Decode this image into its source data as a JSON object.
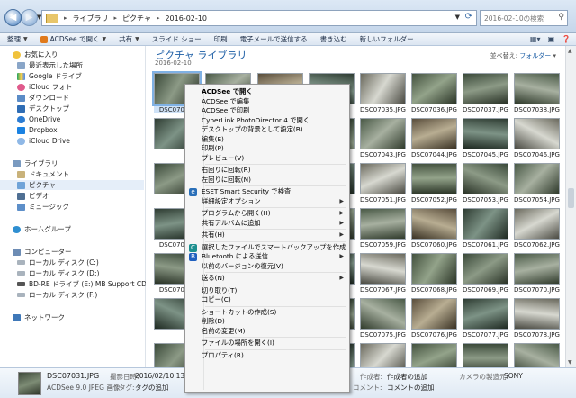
{
  "address": {
    "path": [
      "ライブラリ",
      "ピクチャ",
      "2016-02-10"
    ],
    "search_placeholder": "2016-02-10の検索"
  },
  "toolbar": {
    "items": [
      "整理",
      "ACDSee で開く",
      "共有",
      "スライド ショー",
      "印刷",
      "電子メールで送信する",
      "書き込む",
      "新しいフォルダー"
    ]
  },
  "sidebar": {
    "favorites_header": "お気に入り",
    "favorites": [
      "最近表示した場所",
      "Google ドライブ",
      "iCloud フォト",
      "ダウンロード",
      "デスクトップ",
      "OneDrive",
      "Dropbox",
      "iCloud Drive"
    ],
    "libraries_header": "ライブラリ",
    "libraries": [
      "ドキュメント",
      "ピクチャ",
      "ビデオ",
      "ミュージック"
    ],
    "homegroup": "ホームグループ",
    "computer_header": "コンピューター",
    "drives": [
      "ローカル ディスク (C:)",
      "ローカル ディスク (D:)",
      "BD-RE ドライブ (E:) MB Support CD",
      "ローカル ディスク (F:)"
    ],
    "network": "ネットワーク"
  },
  "library": {
    "title": "ピクチャ ライブラリ",
    "subtitle": "2016-02-10",
    "arrange_label": "並べ替え:",
    "arrange_value": "フォルダー"
  },
  "thumbnails": [
    [
      "DSC07031.",
      "",
      "",
      "",
      "DSC07035.JPG",
      "DSC07036.JPG",
      "DSC07037.JPG",
      "DSC07038.JPG"
    ],
    [
      "",
      "",
      "",
      "",
      "DSC07043.JPG",
      "DSC07044.JPG",
      "DSC07045.JPG",
      "DSC07046.JPG"
    ],
    [
      "",
      "",
      "",
      "",
      "DSC07051.JPG",
      "DSC07052.JPG",
      "DSC07053.JPG",
      "DSC07054.JPG"
    ],
    [
      "DSC07055.",
      "",
      "",
      "",
      "DSC07059.JPG",
      "DSC07060.JPG",
      "DSC07061.JPG",
      "DSC07062.JPG"
    ],
    [
      "DSC07063.",
      "",
      "",
      "",
      "DSC07067.JPG",
      "DSC07068.JPG",
      "DSC07069.JPG",
      "DSC07070.JPG"
    ],
    [
      "",
      "",
      "",
      "",
      "DSC07075.JPG",
      "DSC07076.JPG",
      "DSC07077.JPG",
      "DSC07078.JPG"
    ],
    [
      "",
      "",
      "",
      "",
      "",
      "",
      "",
      ""
    ]
  ],
  "context_menu": {
    "items": [
      {
        "label": "ACDSee で開く",
        "bold": true
      },
      {
        "label": "ACDSee で編集"
      },
      {
        "label": "ACDSee で印刷"
      },
      {
        "label": "CyberLink PhotoDirector 4 で開く"
      },
      {
        "label": "デスクトップの背景として設定(B)"
      },
      {
        "label": "編集(E)"
      },
      {
        "label": "印刷(P)"
      },
      {
        "label": "プレビュー(V)"
      },
      {
        "sep": true
      },
      {
        "label": "右回りに回転(R)"
      },
      {
        "label": "左回りに回転(N)"
      },
      {
        "sep": true
      },
      {
        "label": "ESET Smart Security で検査",
        "icon": "eset-icon"
      },
      {
        "label": "詳細設定オプション",
        "sub": true
      },
      {
        "sep": true
      },
      {
        "label": "プログラムから開く(H)",
        "sub": true
      },
      {
        "label": "共有アルバムに追加",
        "sub": true
      },
      {
        "sep": true
      },
      {
        "label": "共有(H)",
        "sub": true
      },
      {
        "sep": true
      },
      {
        "label": "選択したファイルでスマートバックアップを作成",
        "icon": "backup-icon"
      },
      {
        "label": "Bluetooth による送信",
        "icon": "bluetooth-icon",
        "sub": true
      },
      {
        "label": "以前のバージョンの復元(V)"
      },
      {
        "sep": true
      },
      {
        "label": "送る(N)",
        "sub": true
      },
      {
        "sep": true
      },
      {
        "label": "切り取り(T)"
      },
      {
        "label": "コピー(C)"
      },
      {
        "sep": true
      },
      {
        "label": "ショートカットの作成(S)"
      },
      {
        "label": "削除(D)"
      },
      {
        "label": "名前の変更(M)"
      },
      {
        "sep": true
      },
      {
        "label": "ファイルの場所を開く(I)"
      },
      {
        "sep": true
      },
      {
        "label": "プロパティ(R)"
      }
    ]
  },
  "details": {
    "filename": "DSC07031.JPG",
    "filetype": "ACDSee 9.0 JPEG 画像",
    "date_label": "撮影日時:",
    "date_value": "2016/02/10 13:16",
    "tags_label": "タグ:",
    "tags_value": "タグの追加",
    "author_label": "作成者:",
    "author_value": "作成者の追加",
    "comment_label": "コメント:",
    "comment_value": "コメントの追加",
    "camera_label": "カメラの製造元:",
    "camera_value": "SONY"
  },
  "colors": {
    "accent": "#1e5fa6",
    "selection": "#cfe2f7",
    "menu_bg": "#f5f5f5"
  }
}
